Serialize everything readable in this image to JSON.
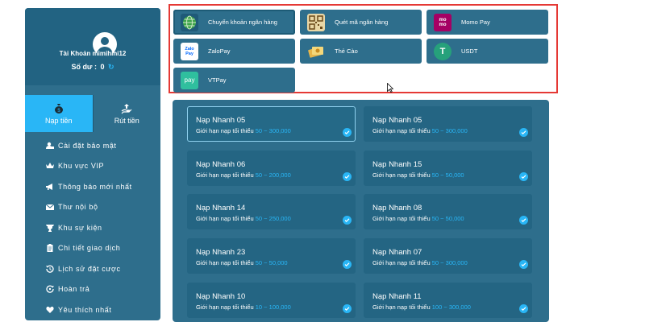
{
  "profile": {
    "account_label": "Tài Khoản mimihihi12",
    "balance_label": "Số dư :",
    "balance_value": "0"
  },
  "tabs": [
    {
      "label": "Nạp tiền",
      "icon": "money-bag-icon",
      "active": true
    },
    {
      "label": "Rút tiền",
      "icon": "withdraw-hand-icon",
      "active": false
    }
  ],
  "menu": [
    {
      "label": "Cài đặt bảo mật",
      "icon": "user-lock-icon"
    },
    {
      "label": "Khu vực VIP",
      "icon": "crown-icon"
    },
    {
      "label": "Thông báo mới nhất",
      "icon": "megaphone-icon"
    },
    {
      "label": "Thư nội bộ",
      "icon": "envelope-icon"
    },
    {
      "label": "Khu sự kiện",
      "icon": "trophy-icon"
    },
    {
      "label": "Chi tiết giao dịch",
      "icon": "clipboard-icon"
    },
    {
      "label": "Lịch sử đặt cược",
      "icon": "history-icon"
    },
    {
      "label": "Hoàn trả",
      "icon": "refund-icon"
    },
    {
      "label": "Yêu thích nhất",
      "icon": "heart-icon"
    }
  ],
  "payment_methods": [
    {
      "label": "Chuyển khoản ngân hàng",
      "icon": "globe-icon",
      "active": true
    },
    {
      "label": "Quét mã ngân hàng",
      "icon": "qr-code-icon",
      "active": false
    },
    {
      "label": "Momo Pay",
      "icon": "momo-icon",
      "logo_text": "mo mo",
      "active": false
    },
    {
      "label": "ZaloPay",
      "icon": "zalopay-icon",
      "logo_text": "Zalo Pay",
      "active": false
    },
    {
      "label": "Thẻ Cào",
      "icon": "scratch-card-icon",
      "active": false
    },
    {
      "label": "USDT",
      "icon": "tether-icon",
      "logo_text": "T",
      "active": false
    },
    {
      "label": "VTPay",
      "icon": "vtpay-icon",
      "logo_text": "pay",
      "active": false
    }
  ],
  "deposit_options": [
    {
      "title": "Nạp Nhanh 05",
      "limit_label": "Giới hạn nạp tối thiểu",
      "min": "50",
      "max": "300,000",
      "selected": true
    },
    {
      "title": "Nạp Nhanh 05",
      "limit_label": "Giới hạn nạp tối thiểu",
      "min": "50",
      "max": "300,000",
      "selected": false
    },
    {
      "title": "Nạp Nhanh 06",
      "limit_label": "Giới hạn nạp tối thiểu",
      "min": "50",
      "max": "200,000",
      "selected": false
    },
    {
      "title": "Nạp Nhanh 15",
      "limit_label": "Giới hạn nạp tối thiểu",
      "min": "50",
      "max": "50,000",
      "selected": false
    },
    {
      "title": "Nạp Nhanh 14",
      "limit_label": "Giới hạn nạp tối thiểu",
      "min": "50",
      "max": "250,000",
      "selected": false
    },
    {
      "title": "Nạp Nhanh 08",
      "limit_label": "Giới hạn nạp tối thiểu",
      "min": "50",
      "max": "50,000",
      "selected": false
    },
    {
      "title": "Nạp Nhanh 23",
      "limit_label": "Giới hạn nạp tối thiểu",
      "min": "50",
      "max": "50,000",
      "selected": false
    },
    {
      "title": "Nạp Nhanh 07",
      "limit_label": "Giới hạn nạp tối thiểu",
      "min": "50",
      "max": "300,000",
      "selected": false
    },
    {
      "title": "Nạp Nhanh 10",
      "limit_label": "Giới hạn nạp tối thiểu",
      "min": "10",
      "max": "100,000",
      "selected": false
    },
    {
      "title": "Nạp Nhanh 11",
      "limit_label": "Giới hạn nạp tối thiểu",
      "min": "100",
      "max": "300,000",
      "selected": false
    }
  ],
  "range_separator": "~",
  "colors": {
    "accent": "#29b6f6",
    "panel": "#2e6e8c",
    "card": "#246583",
    "highlight_border": "#e53935"
  }
}
